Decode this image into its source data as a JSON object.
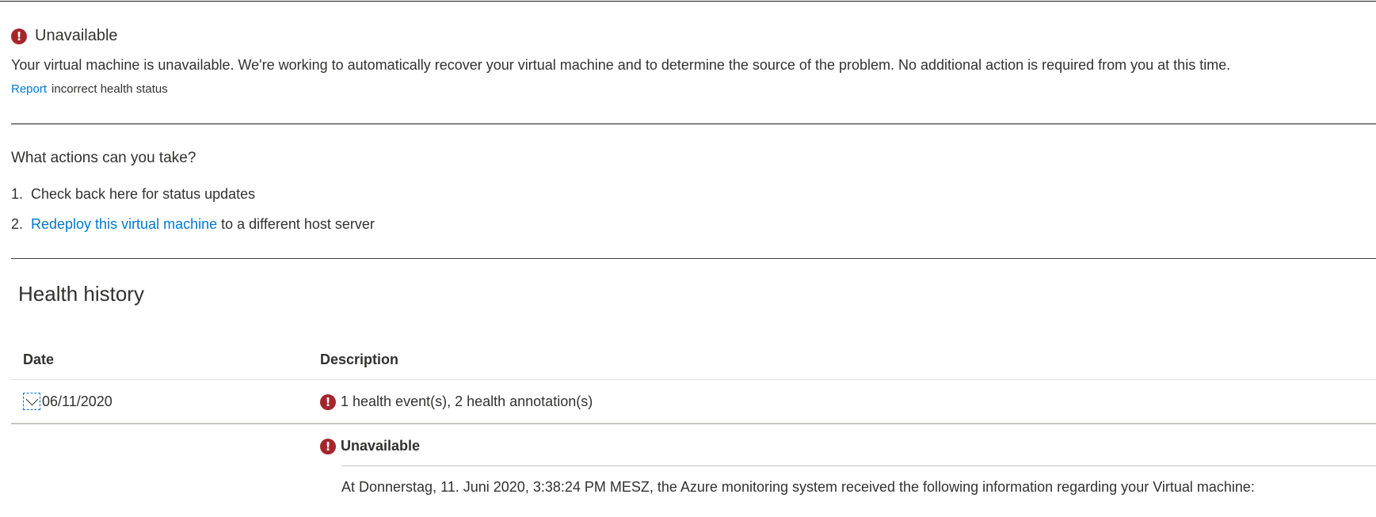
{
  "status": {
    "title": "Unavailable",
    "description": "Your virtual machine is unavailable. We're working to automatically recover your virtual machine and to determine the source of the problem. No additional action is required from you at this time.",
    "report_link": "Report",
    "report_rest": "incorrect health status",
    "icon": "error-icon",
    "color": "#a4262c"
  },
  "actions": {
    "heading": "What actions can you take?",
    "items": [
      {
        "num": "1.",
        "text": "Check back here for status updates"
      },
      {
        "num": "2.",
        "link": "Redeploy this virtual machine",
        "text": "to a different host server"
      }
    ]
  },
  "health_history": {
    "title": "Health history",
    "columns": {
      "date": "Date",
      "description": "Description"
    },
    "rows": [
      {
        "date": "06/11/2020",
        "description": "1 health event(s), 2 health annotation(s)",
        "expanded": true,
        "detail": {
          "title": "Unavailable",
          "text": "At Donnerstag, 11. Juni 2020, 3:38:24 PM MESZ, the Azure monitoring system received the following information regarding your Virtual machine:"
        }
      }
    ]
  },
  "colors": {
    "link": "#0078d4",
    "error": "#a4262c",
    "text": "#323130"
  }
}
